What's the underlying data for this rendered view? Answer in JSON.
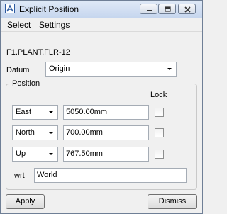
{
  "window": {
    "title": "Explicit Position",
    "controls": [
      "minimize-icon",
      "restore-icon",
      "close-icon"
    ]
  },
  "menu": {
    "items": [
      "Select",
      "Settings"
    ]
  },
  "element": {
    "name": "F1.PLANT.FLR-12"
  },
  "datum": {
    "label": "Datum",
    "value": "Origin"
  },
  "position": {
    "group_label": "Position",
    "lock_label": "Lock",
    "rows": [
      {
        "direction": "East",
        "value": "5050.00mm",
        "locked": false
      },
      {
        "direction": "North",
        "value": "700.00mm",
        "locked": false
      },
      {
        "direction": "Up",
        "value": "767.50mm",
        "locked": false
      }
    ],
    "wrt_label": "wrt",
    "wrt_value": "World"
  },
  "buttons": {
    "apply": "Apply",
    "dismiss": "Dismiss"
  }
}
